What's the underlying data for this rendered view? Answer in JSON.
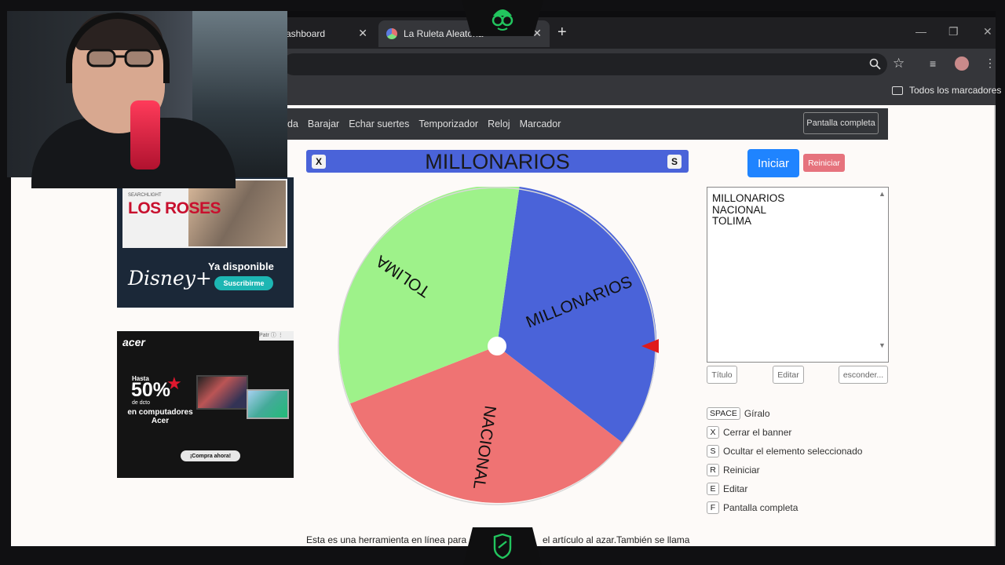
{
  "browser": {
    "tabs": [
      {
        "label": "ashboard",
        "active": false
      },
      {
        "label": "La Ruleta Aleatoria",
        "active": true
      }
    ],
    "new_tab": "+",
    "window_controls": [
      "—",
      "❐",
      "✕"
    ],
    "bookmarks_label": "Todos los marcadores"
  },
  "site": {
    "nav": [
      "da",
      "Barajar",
      "Echar suertes",
      "Temporizador",
      "Reloj",
      "Marcador"
    ],
    "fullscreen_button": "Pantalla completa",
    "banner": {
      "title": "MILLONARIOS",
      "left_key": "X",
      "right_key": "S"
    },
    "wheel": {
      "segments": [
        {
          "label": "MILLONARIOS",
          "color": "#4a63d9"
        },
        {
          "label": "NACIONAL",
          "color": "#ef7373"
        },
        {
          "label": "TOLIMA",
          "color": "#9ef28a"
        }
      ],
      "pointer_color": "#e01b1b"
    },
    "buttons": {
      "start": "Iniciar",
      "reset": "Reiniciar"
    },
    "entries_text": "MILLONARIOS\nNACIONAL\nTOLIMA",
    "small_buttons": [
      "Título",
      "Editar",
      "esconder..."
    ],
    "shortcuts": [
      {
        "key": "SPACE",
        "label": "Gíralo"
      },
      {
        "key": "X",
        "label": "Cerrar el banner"
      },
      {
        "key": "S",
        "label": "Ocultar el elemento seleccionado"
      },
      {
        "key": "R",
        "label": "Reiniciar"
      },
      {
        "key": "E",
        "label": "Editar"
      },
      {
        "key": "F",
        "label": "Pantalla completa"
      }
    ],
    "footer_left": "Esta es una herramienta en línea para el",
    "footer_right": "el artículo al azar.También se llama"
  },
  "ads": {
    "ad1": {
      "small": "SEARCHLIGHT",
      "title": "LOS ROSES",
      "brand": "Disney+",
      "available": "Ya disponible",
      "cta": "Suscribirme"
    },
    "ad2": {
      "brand": "acer",
      "pre": "Hasta",
      "discount": "50%",
      "sub": "de dcto",
      "line": "en computadores Acer",
      "cta": "¡Compra ahora!",
      "badge": "Patr"
    }
  }
}
